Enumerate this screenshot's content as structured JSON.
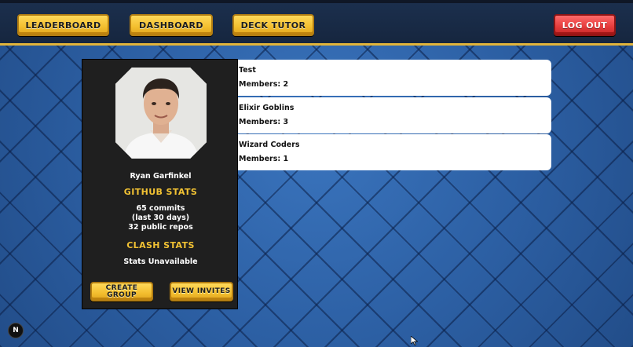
{
  "nav": {
    "leaderboard_label": "LEADERBOARD",
    "dashboard_label": "DASHBOARD",
    "deck_tutor_label": "DECK TUTOR",
    "logout_label": "LOG OUT"
  },
  "profile": {
    "name": "Ryan Garfinkel",
    "github_heading": "GITHUB STATS",
    "commits": "65 commits",
    "commits_period": "(last 30 days)",
    "repos": "32 public repos",
    "clash_heading": "CLASH STATS",
    "clash_status": "Stats Unavailable",
    "create_group_label_line1": "CREATE",
    "create_group_label_line2": "GROUP",
    "view_invites_label": "VIEW INVITES"
  },
  "groups": [
    {
      "name": "Test",
      "members": "Members: 2"
    },
    {
      "name": "Elixir Goblins",
      "members": "Members: 3"
    },
    {
      "name": "Wizard Coders",
      "members": "Members: 1"
    }
  ],
  "badge": {
    "letter": "N"
  },
  "colors": {
    "gold": "#f2c233",
    "logout_red": "#e43b3b",
    "card_dark": "#1f1f1f",
    "background_blue": "#2b5c9e"
  }
}
